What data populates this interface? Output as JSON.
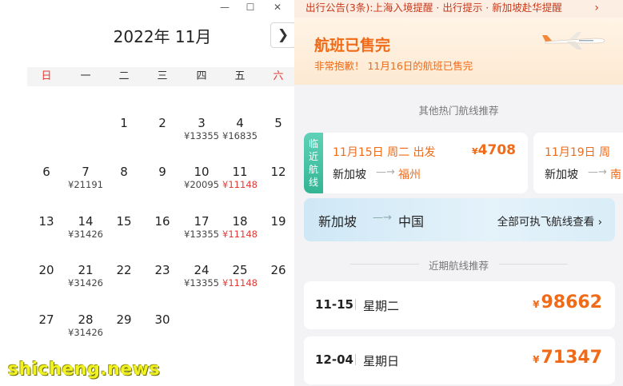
{
  "calendar": {
    "title": "2022年 11月",
    "next_icon": "chevron-right-icon",
    "window_controls": [
      "—",
      "☐",
      "✕"
    ],
    "weekdays": [
      {
        "label": "日",
        "red": true
      },
      {
        "label": "一",
        "red": false
      },
      {
        "label": "二",
        "red": false
      },
      {
        "label": "三",
        "red": false
      },
      {
        "label": "四",
        "red": false
      },
      {
        "label": "五",
        "red": false
      },
      {
        "label": "六",
        "red": true
      }
    ],
    "days": [
      {
        "n": "1",
        "col": 2,
        "row": 0,
        "price": ""
      },
      {
        "n": "2",
        "col": 3,
        "row": 0,
        "price": ""
      },
      {
        "n": "3",
        "col": 4,
        "row": 0,
        "price": "¥13355"
      },
      {
        "n": "4",
        "col": 5,
        "row": 0,
        "price": "¥16835"
      },
      {
        "n": "5",
        "col": 6,
        "row": 0,
        "price": ""
      },
      {
        "n": "6",
        "col": 0,
        "row": 1,
        "price": ""
      },
      {
        "n": "7",
        "col": 1,
        "row": 1,
        "price": "¥21191"
      },
      {
        "n": "8",
        "col": 2,
        "row": 1,
        "price": ""
      },
      {
        "n": "9",
        "col": 3,
        "row": 1,
        "price": ""
      },
      {
        "n": "10",
        "col": 4,
        "row": 1,
        "price": "¥20095"
      },
      {
        "n": "11",
        "col": 5,
        "row": 1,
        "price": "¥11148",
        "low": true
      },
      {
        "n": "12",
        "col": 6,
        "row": 1,
        "price": ""
      },
      {
        "n": "13",
        "col": 0,
        "row": 2,
        "price": ""
      },
      {
        "n": "14",
        "col": 1,
        "row": 2,
        "price": "¥31426"
      },
      {
        "n": "15",
        "col": 2,
        "row": 2,
        "price": ""
      },
      {
        "n": "16",
        "col": 3,
        "row": 2,
        "price": ""
      },
      {
        "n": "17",
        "col": 4,
        "row": 2,
        "price": "¥13355"
      },
      {
        "n": "18",
        "col": 5,
        "row": 2,
        "price": "¥11148",
        "low": true
      },
      {
        "n": "19",
        "col": 6,
        "row": 2,
        "price": ""
      },
      {
        "n": "20",
        "col": 0,
        "row": 3,
        "price": ""
      },
      {
        "n": "21",
        "col": 1,
        "row": 3,
        "price": "¥31426"
      },
      {
        "n": "22",
        "col": 2,
        "row": 3,
        "price": ""
      },
      {
        "n": "23",
        "col": 3,
        "row": 3,
        "price": ""
      },
      {
        "n": "24",
        "col": 4,
        "row": 3,
        "price": "¥13355"
      },
      {
        "n": "25",
        "col": 5,
        "row": 3,
        "price": "¥11148",
        "low": true
      },
      {
        "n": "26",
        "col": 6,
        "row": 3,
        "price": ""
      },
      {
        "n": "27",
        "col": 0,
        "row": 4,
        "price": ""
      },
      {
        "n": "28",
        "col": 1,
        "row": 4,
        "price": "¥31426"
      },
      {
        "n": "29",
        "col": 2,
        "row": 4,
        "price": ""
      },
      {
        "n": "30",
        "col": 3,
        "row": 4,
        "price": ""
      }
    ]
  },
  "app": {
    "notice": "出行公告(3条):上海入境提醒 · 出行提示 · 新加坡赴华提醒",
    "notice_arrow": "›",
    "soldout_title": "航班已售完",
    "soldout_sub": "非常抱歉！ 11月16日的航班已售完",
    "plane_icon": "airplane-icon",
    "hot_heading": "其他热门航线推荐",
    "card1": {
      "tag": [
        "临",
        "近",
        "航",
        "线"
      ],
      "date": "11月15日 周二 出发",
      "currency": "¥",
      "price": "4708",
      "from": "新加坡",
      "to": "福州"
    },
    "card2": {
      "date": "11月19日 周",
      "from": "新加坡",
      "to": "南"
    },
    "banner": {
      "from": "新加坡",
      "to": "中国",
      "link": "全部可执飞航线查看 ›"
    },
    "recent_heading": "近期航线推荐",
    "recent": [
      {
        "date": "11-15",
        "week": "星期二",
        "currency": "¥",
        "price": "98662"
      },
      {
        "date": "12-04",
        "week": "星期日",
        "currency": "¥",
        "price": "71347"
      }
    ]
  },
  "watermark": "shicheng.news",
  "colors": {
    "accent": "#f06a17",
    "sale_red": "#e53935",
    "teal_tag": "#33b594"
  }
}
